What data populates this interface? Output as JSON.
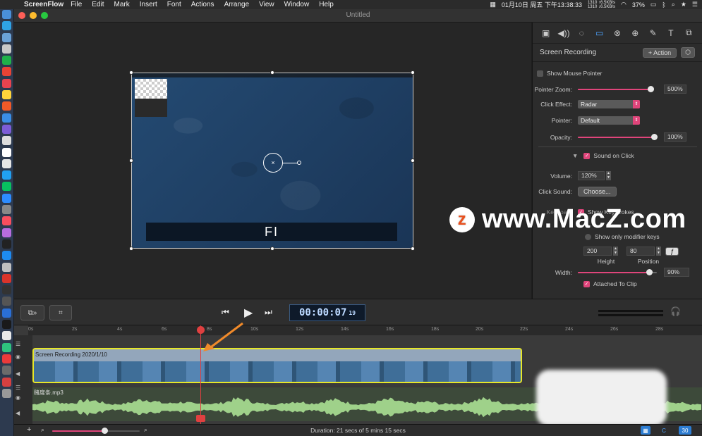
{
  "menubar": {
    "app": "ScreenFlow",
    "items": [
      "File",
      "Edit",
      "Mark",
      "Insert",
      "Font",
      "Actions",
      "Arrange",
      "View",
      "Window",
      "Help"
    ],
    "net_line1": "1310 ↑6.5KB/s",
    "net_line2": "1310 ↓6.5KB/s",
    "battery": "37%",
    "datetime": "01月10日 周五 下午13:38:33"
  },
  "window": {
    "title": "Untitled"
  },
  "canvas": {
    "caption_text": "FI"
  },
  "inspector": {
    "section_title": "Screen Recording",
    "action_button": "+ Action",
    "show_mouse_pointer": "Show Mouse Pointer",
    "pointer_zoom_label": "Pointer Zoom:",
    "pointer_zoom_value": "500%",
    "pointer_zoom_level": 0.95,
    "click_effect_label": "Click Effect:",
    "click_effect_value": "Radar",
    "pointer_label": "Pointer:",
    "pointer_value": "Default",
    "opacity_label": "Opacity:",
    "opacity_value": "100%",
    "opacity_level": 1.0,
    "sound_on_click": "Sound on Click",
    "volume_label": "Volume:",
    "volume_value": "120%",
    "click_sound_label": "Click Sound:",
    "choose_button": "Choose...",
    "keystrokes_label": "Keyboard",
    "show_keystrokes": "Show Keystrokes",
    "show_modifier": "Show only modifier keys",
    "kb_height_value": "200",
    "kb_position_value": "80",
    "height_label": "Height",
    "position_label": "Position",
    "width_label": "Width:",
    "width_value": "90%",
    "width_level": 0.9,
    "attached_to_clip": "Attached To Clip",
    "toolbar_icons": [
      "video-props-icon",
      "audio-props-icon",
      "video-motion-icon",
      "screen-recording-icon",
      "callout-icon",
      "touch-icon",
      "annotation-icon",
      "text-icon",
      "media-library-icon"
    ]
  },
  "watermark": {
    "text": "www.MacZ.com",
    "logo": "z"
  },
  "transport": {
    "timecode": "00:00:07",
    "frames": "19"
  },
  "timeline": {
    "ruler": [
      "0s",
      "2s",
      "4s",
      "6s",
      "8s",
      "10s",
      "12s",
      "14s",
      "16s",
      "18s",
      "20s",
      "22s",
      "24s",
      "26s",
      "28s"
    ],
    "video_clip": "Screen Recording 2020/1/10",
    "audio_clip": "赌度条.mp3",
    "playhead_time_s": 7.8
  },
  "status": {
    "duration": "Duration: 21 secs of 5 mins 15 secs",
    "zoom_level": 0.6,
    "counter": "30"
  },
  "colors": {
    "accent": "#e0457b",
    "clip_border": "#e6e62a",
    "playhead": "#e04040",
    "arrow": "#f08a2a"
  }
}
